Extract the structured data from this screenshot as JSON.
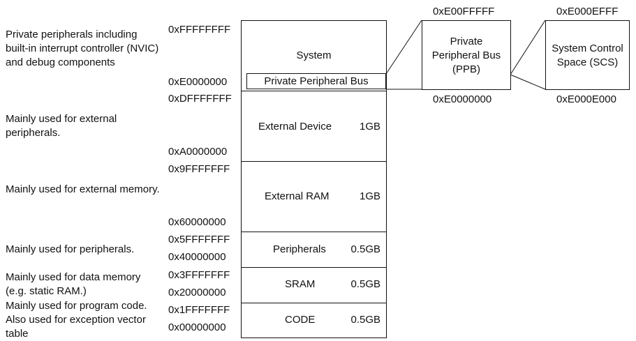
{
  "descriptions": {
    "system": "Private peripherals including built-in interrupt controller (NVIC) and debug components",
    "external_device": "Mainly used for external peripherals.",
    "external_ram": "Mainly used for external memory.",
    "peripherals": "Mainly used for peripherals.",
    "sram": "Mainly used for data memory (e.g. static RAM.)",
    "code": "Mainly used for program code. Also used for exception vector table"
  },
  "addresses": {
    "system_top": "0xFFFFFFFF",
    "system_bottom": "0xE0000000",
    "external_device_top": "0xDFFFFFFF",
    "external_device_bottom": "0xA0000000",
    "external_ram_top": "0x9FFFFFFF",
    "external_ram_bottom": "0x60000000",
    "peripherals_top": "0x5FFFFFFF",
    "peripherals_bottom": "0x40000000",
    "sram_top": "0x3FFFFFFF",
    "sram_bottom": "0x20000000",
    "code_top": "0x1FFFFFFF",
    "code_bottom": "0x00000000"
  },
  "regions": {
    "system": {
      "name": "System",
      "ppb_label": "Private Peripheral Bus"
    },
    "external_device": {
      "name": "External Device",
      "size": "1GB"
    },
    "external_ram": {
      "name": "External RAM",
      "size": "1GB"
    },
    "peripherals": {
      "name": "Peripherals",
      "size": "0.5GB"
    },
    "sram": {
      "name": "SRAM",
      "size": "0.5GB"
    },
    "code": {
      "name": "CODE",
      "size": "0.5GB"
    }
  },
  "ppb_zoom": {
    "label": "Private Peripheral Bus (PPB)",
    "top_address": "0xE00FFFFF",
    "bottom_address": "0xE0000000"
  },
  "scs_zoom": {
    "label": "System Control Space (SCS)",
    "top_address": "0xE000EFFF",
    "bottom_address": "0xE000E000"
  }
}
